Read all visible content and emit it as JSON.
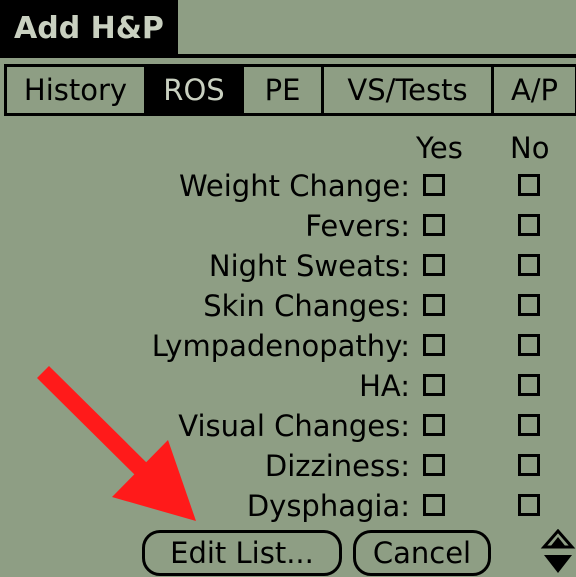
{
  "window": {
    "title": "Add H&P"
  },
  "tabs": [
    {
      "label": "History",
      "active": false
    },
    {
      "label": "ROS",
      "active": true
    },
    {
      "label": "PE",
      "active": false
    },
    {
      "label": "VS/Tests",
      "active": false
    },
    {
      "label": "A/P",
      "active": false
    }
  ],
  "columns": {
    "yes": "Yes",
    "no": "No"
  },
  "ros_items": [
    {
      "label": "Weight Change:",
      "yes": false,
      "no": false
    },
    {
      "label": "Fevers:",
      "yes": false,
      "no": false
    },
    {
      "label": "Night Sweats:",
      "yes": false,
      "no": false
    },
    {
      "label": "Skin Changes:",
      "yes": false,
      "no": false
    },
    {
      "label": "Lympadenopathy:",
      "yes": false,
      "no": false
    },
    {
      "label": "HA:",
      "yes": false,
      "no": false
    },
    {
      "label": "Visual Changes:",
      "yes": false,
      "no": false
    },
    {
      "label": "Dizziness:",
      "yes": false,
      "no": false
    },
    {
      "label": "Dysphagia:",
      "yes": false,
      "no": false
    }
  ],
  "buttons": {
    "edit_list": "Edit List...",
    "cancel": "Cancel"
  },
  "icons": {
    "scroll": "scroll-up-down-icon",
    "annotation": "red-arrow-annotation"
  },
  "colors": {
    "screen": "#8e9e84",
    "ink": "#000000",
    "annotation": "#ff1a1a"
  }
}
